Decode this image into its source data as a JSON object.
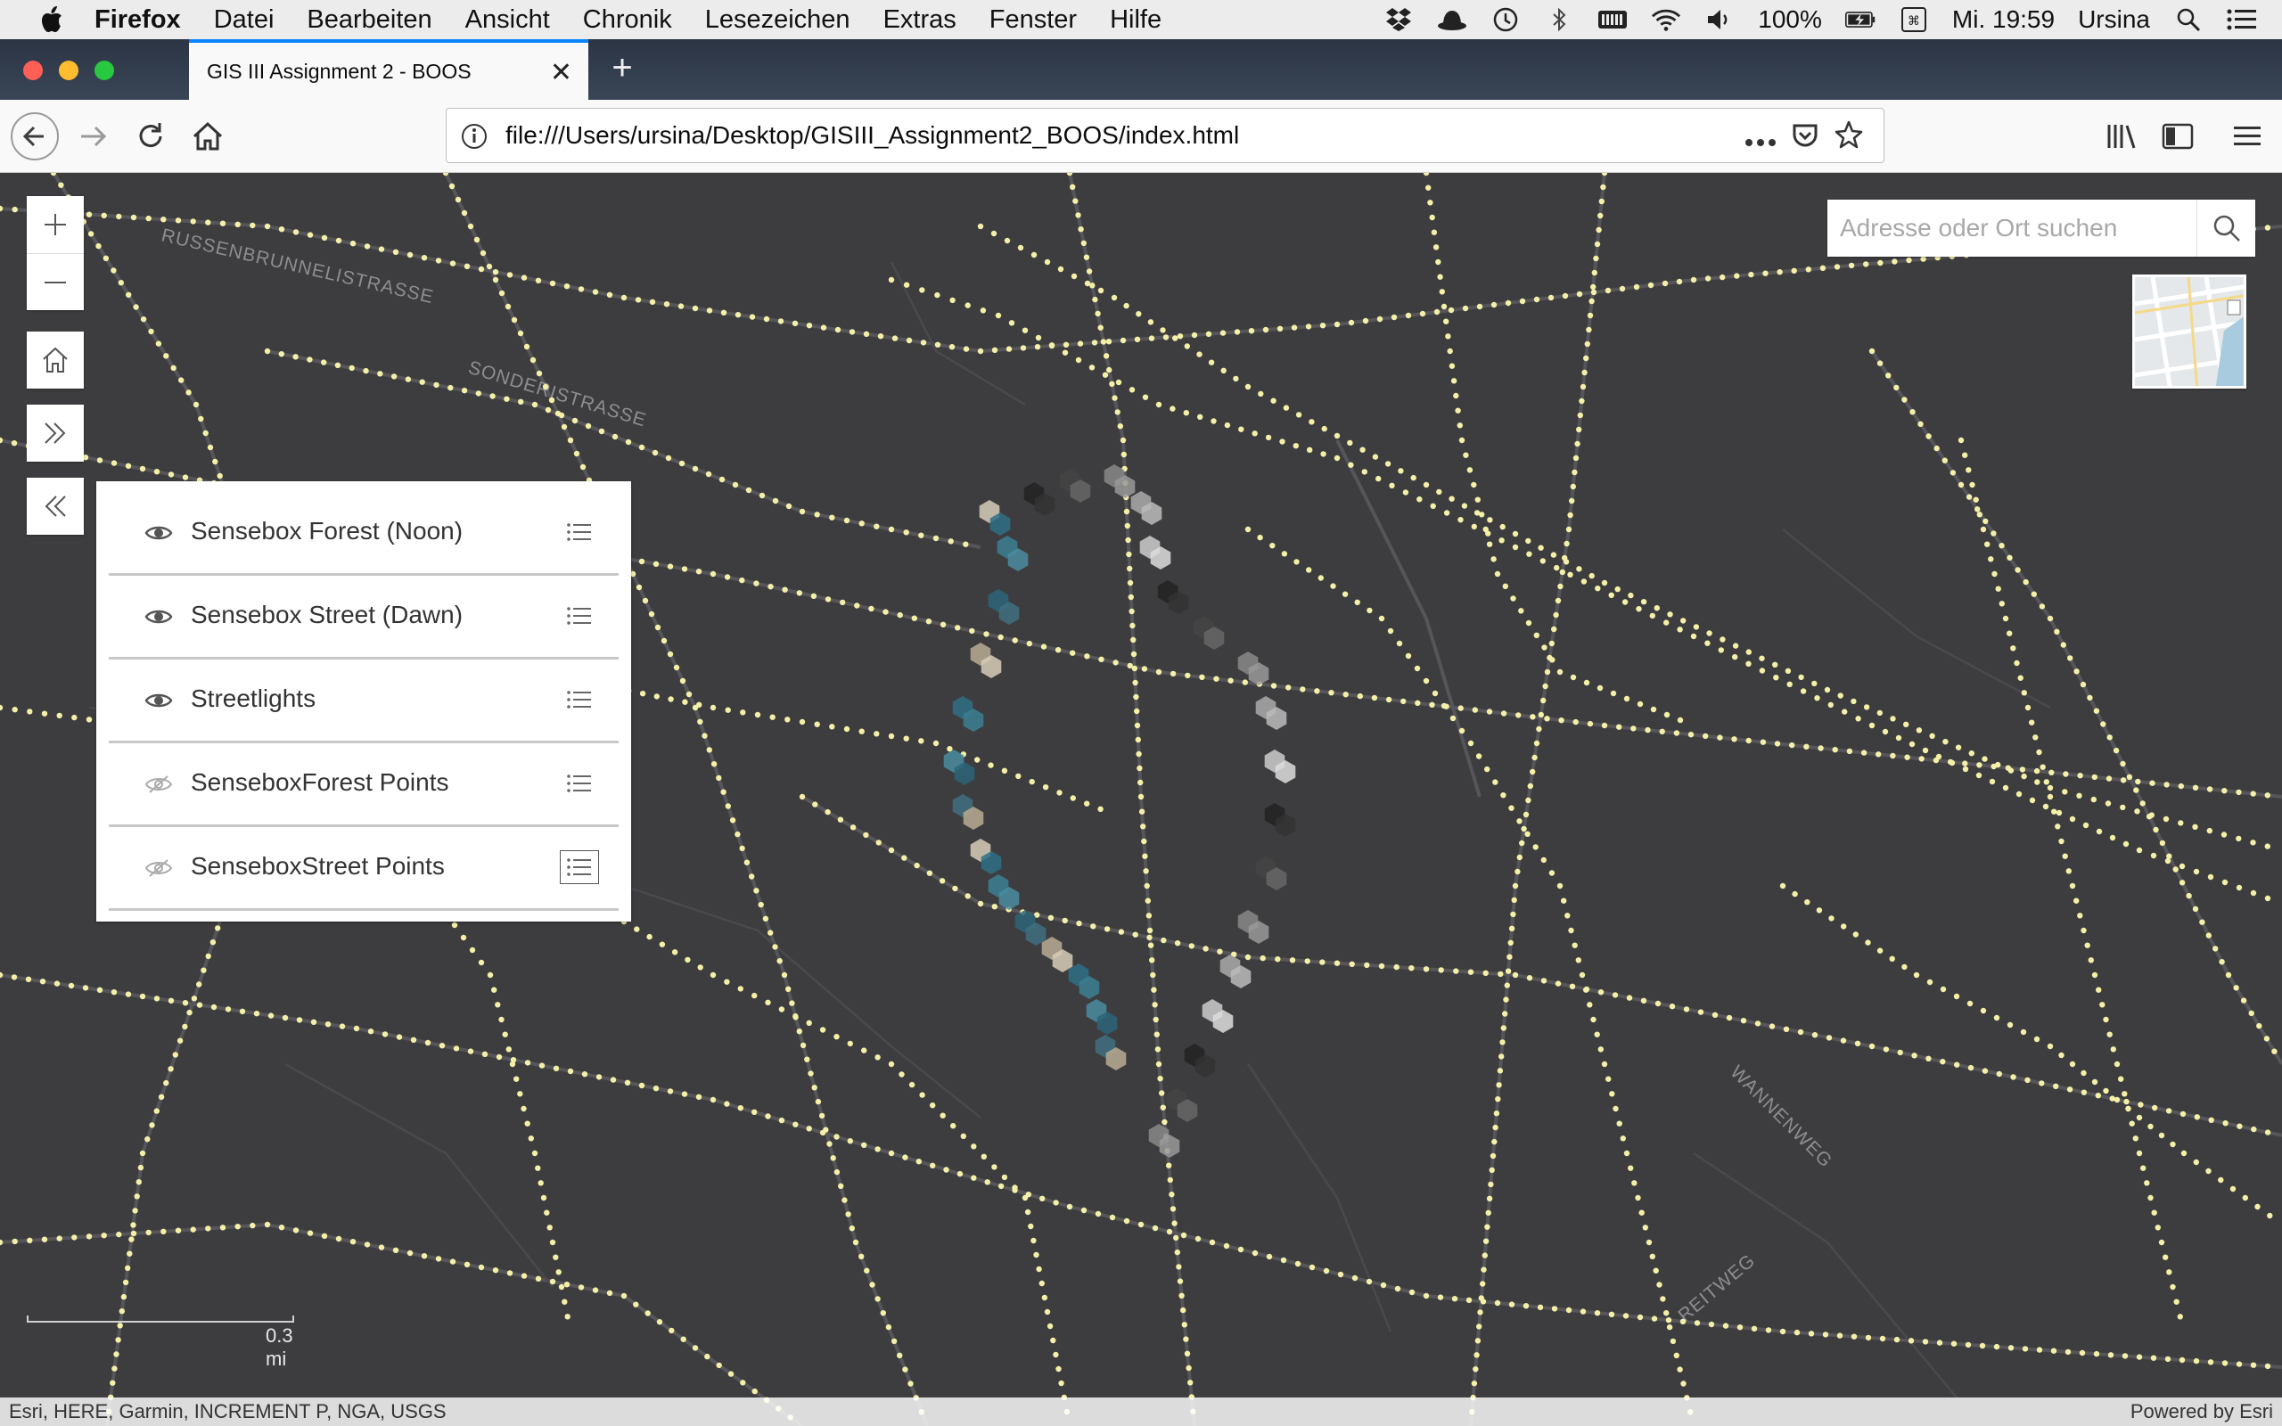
{
  "menubar": {
    "app_name": "Firefox",
    "items": [
      "Datei",
      "Bearbeiten",
      "Ansicht",
      "Chronik",
      "Lesezeichen",
      "Extras",
      "Fenster",
      "Hilfe"
    ],
    "battery": "100%",
    "clock": "Mi. 19:59",
    "user": "Ursina",
    "icons": [
      "dropbox-icon",
      "hat-icon",
      "time-machine-icon",
      "bluetooth-icon",
      "keyboard-icon",
      "wifi-icon",
      "volume-icon",
      "battery-icon",
      "input-menu-icon",
      "spotlight-icon",
      "notification-center-icon"
    ]
  },
  "browser": {
    "tab_title": "GIS III Assignment 2 - BOOS",
    "url": "file:///Users/ursina/Desktop/GISIII_Assignment2_BOOS/index.html",
    "accent_color": "#0a84ff"
  },
  "map": {
    "search_placeholder": "Adresse oder Ort suchen",
    "scale_label": "0.3 mi",
    "attribution_left": "Esri, HERE, Garmin, INCREMENT P, NGA, USGS",
    "attribution_right": "Powered by Esri",
    "street_labels": [
      "RUSSENBRUNNELISTRASSE",
      "SONDERISTRASSE",
      "WANNENWEG",
      "REITWEG"
    ],
    "streetlight_color": "#f4f0a8",
    "layers": [
      {
        "label": "Sensebox Forest (Noon)",
        "visible": true
      },
      {
        "label": "Sensebox Street (Dawn)",
        "visible": true
      },
      {
        "label": "Streetlights",
        "visible": true
      },
      {
        "label": "SenseboxForest Points",
        "visible": false
      },
      {
        "label": "SenseboxStreet Points",
        "visible": false
      }
    ]
  }
}
